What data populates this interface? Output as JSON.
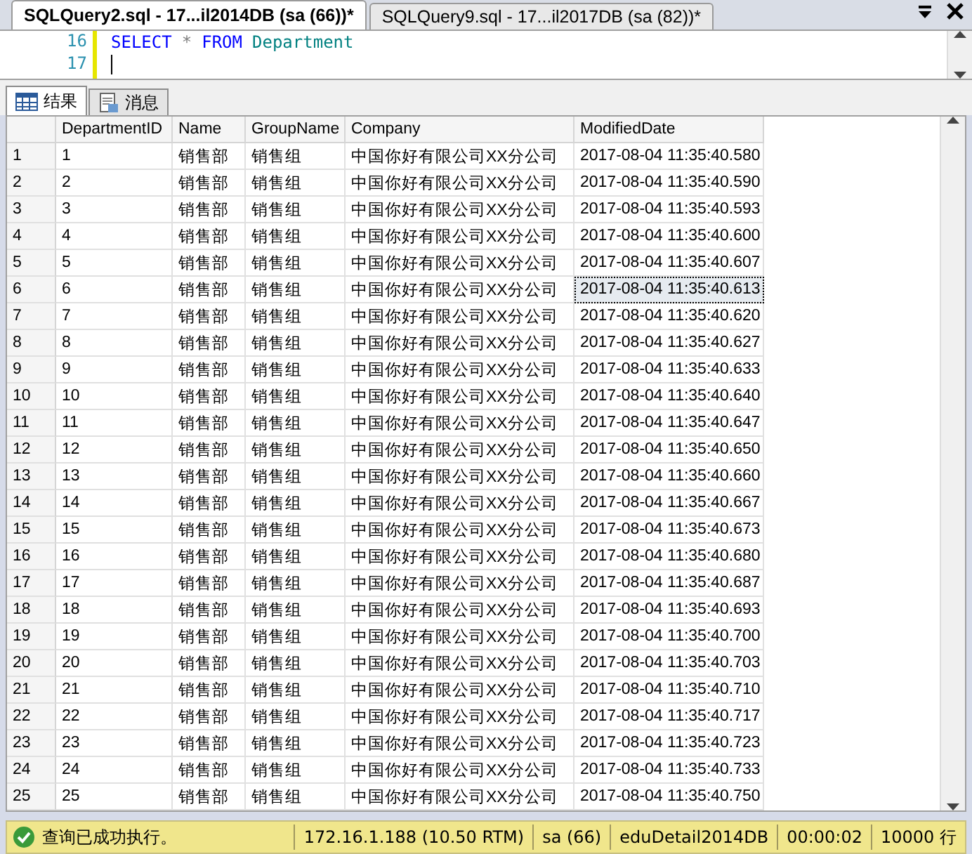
{
  "doc_tabs": [
    {
      "label": "SQLQuery2.sql - 17...il2014DB (sa (66))*",
      "selected": true
    },
    {
      "label": "SQLQuery9.sql - 17...il2017DB (sa (82))*",
      "selected": false
    }
  ],
  "editor": {
    "lines": [
      {
        "number": "16",
        "tokens": [
          {
            "text": "SELECT",
            "kind": "keyword"
          },
          {
            "text": "*",
            "kind": "operator"
          },
          {
            "text": "FROM",
            "kind": "keyword"
          },
          {
            "text": "Department",
            "kind": "identifier"
          }
        ]
      },
      {
        "number": "17"
      }
    ]
  },
  "result_tabs": [
    {
      "label": "结果",
      "selected": true,
      "kind": "grid"
    },
    {
      "label": "消息",
      "selected": false,
      "kind": "messages"
    }
  ],
  "table": {
    "columns": [
      "DepartmentID",
      "Name",
      "GroupName",
      "Company",
      "ModifiedDate"
    ],
    "rows": [
      {
        "num": "1",
        "cells": [
          "1",
          "销售部",
          "销售组",
          "中国你好有限公司XX分公司",
          "2017-08-04 11:35:40.580"
        ],
        "selected": false
      },
      {
        "num": "2",
        "cells": [
          "2",
          "销售部",
          "销售组",
          "中国你好有限公司XX分公司",
          "2017-08-04 11:35:40.590"
        ],
        "selected": false
      },
      {
        "num": "3",
        "cells": [
          "3",
          "销售部",
          "销售组",
          "中国你好有限公司XX分公司",
          "2017-08-04 11:35:40.593"
        ],
        "selected": false
      },
      {
        "num": "4",
        "cells": [
          "4",
          "销售部",
          "销售组",
          "中国你好有限公司XX分公司",
          "2017-08-04 11:35:40.600"
        ],
        "selected": false
      },
      {
        "num": "5",
        "cells": [
          "5",
          "销售部",
          "销售组",
          "中国你好有限公司XX分公司",
          "2017-08-04 11:35:40.607"
        ],
        "selected": false
      },
      {
        "num": "6",
        "cells": [
          "6",
          "销售部",
          "销售组",
          "中国你好有限公司XX分公司",
          "2017-08-04 11:35:40.613"
        ],
        "selected": true
      },
      {
        "num": "7",
        "cells": [
          "7",
          "销售部",
          "销售组",
          "中国你好有限公司XX分公司",
          "2017-08-04 11:35:40.620"
        ],
        "selected": false
      },
      {
        "num": "8",
        "cells": [
          "8",
          "销售部",
          "销售组",
          "中国你好有限公司XX分公司",
          "2017-08-04 11:35:40.627"
        ],
        "selected": false
      },
      {
        "num": "9",
        "cells": [
          "9",
          "销售部",
          "销售组",
          "中国你好有限公司XX分公司",
          "2017-08-04 11:35:40.633"
        ],
        "selected": false
      },
      {
        "num": "10",
        "cells": [
          "10",
          "销售部",
          "销售组",
          "中国你好有限公司XX分公司",
          "2017-08-04 11:35:40.640"
        ],
        "selected": false
      },
      {
        "num": "11",
        "cells": [
          "11",
          "销售部",
          "销售组",
          "中国你好有限公司XX分公司",
          "2017-08-04 11:35:40.647"
        ],
        "selected": false
      },
      {
        "num": "12",
        "cells": [
          "12",
          "销售部",
          "销售组",
          "中国你好有限公司XX分公司",
          "2017-08-04 11:35:40.650"
        ],
        "selected": false
      },
      {
        "num": "13",
        "cells": [
          "13",
          "销售部",
          "销售组",
          "中国你好有限公司XX分公司",
          "2017-08-04 11:35:40.660"
        ],
        "selected": false
      },
      {
        "num": "14",
        "cells": [
          "14",
          "销售部",
          "销售组",
          "中国你好有限公司XX分公司",
          "2017-08-04 11:35:40.667"
        ],
        "selected": false
      },
      {
        "num": "15",
        "cells": [
          "15",
          "销售部",
          "销售组",
          "中国你好有限公司XX分公司",
          "2017-08-04 11:35:40.673"
        ],
        "selected": false
      },
      {
        "num": "16",
        "cells": [
          "16",
          "销售部",
          "销售组",
          "中国你好有限公司XX分公司",
          "2017-08-04 11:35:40.680"
        ],
        "selected": false
      },
      {
        "num": "17",
        "cells": [
          "17",
          "销售部",
          "销售组",
          "中国你好有限公司XX分公司",
          "2017-08-04 11:35:40.687"
        ],
        "selected": false
      },
      {
        "num": "18",
        "cells": [
          "18",
          "销售部",
          "销售组",
          "中国你好有限公司XX分公司",
          "2017-08-04 11:35:40.693"
        ],
        "selected": false
      },
      {
        "num": "19",
        "cells": [
          "19",
          "销售部",
          "销售组",
          "中国你好有限公司XX分公司",
          "2017-08-04 11:35:40.700"
        ],
        "selected": false
      },
      {
        "num": "20",
        "cells": [
          "20",
          "销售部",
          "销售组",
          "中国你好有限公司XX分公司",
          "2017-08-04 11:35:40.703"
        ],
        "selected": false
      },
      {
        "num": "21",
        "cells": [
          "21",
          "销售部",
          "销售组",
          "中国你好有限公司XX分公司",
          "2017-08-04 11:35:40.710"
        ],
        "selected": false
      },
      {
        "num": "22",
        "cells": [
          "22",
          "销售部",
          "销售组",
          "中国你好有限公司XX分公司",
          "2017-08-04 11:35:40.717"
        ],
        "selected": false
      },
      {
        "num": "23",
        "cells": [
          "23",
          "销售部",
          "销售组",
          "中国你好有限公司XX分公司",
          "2017-08-04 11:35:40.723"
        ],
        "selected": false
      },
      {
        "num": "24",
        "cells": [
          "24",
          "销售部",
          "销售组",
          "中国你好有限公司XX分公司",
          "2017-08-04 11:35:40.733"
        ],
        "selected": false
      },
      {
        "num": "25",
        "cells": [
          "25",
          "销售部",
          "销售组",
          "中国你好有限公司XX分公司",
          "2017-08-04 11:35:40.750"
        ],
        "selected": false
      }
    ]
  },
  "status_bar": {
    "message": "查询已成功执行。",
    "server": "172.16.1.188 (10.50 RTM)",
    "user": "sa (66)",
    "database": "eduDetail2014DB",
    "elapsed": "00:00:02",
    "rows": "10000 行"
  }
}
